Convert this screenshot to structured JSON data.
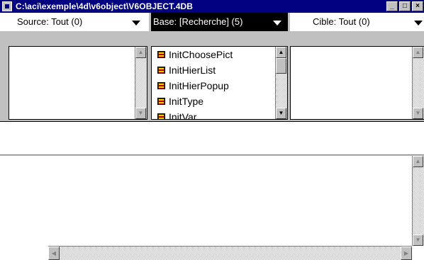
{
  "window": {
    "title": "C:\\aci\\exemple\\4d\\v6object\\V6OBJECT.4DB",
    "controls": {
      "minimize": "_",
      "maximize": "□",
      "close": "×"
    }
  },
  "headers": {
    "source": "Source: Tout (0)",
    "base": "Base: [Recherche] (5)",
    "cible": "Cible: Tout (0)"
  },
  "base_list": {
    "items": [
      "InitChoosePict",
      "InitHierList",
      "InitHierPopup",
      "InitType",
      "InitVar"
    ]
  },
  "icons": {
    "app": "4d-app-icon",
    "dropdown": "chevron-down-icon",
    "item": "method-icon",
    "up": "arrow-up-icon",
    "down": "arrow-down-icon",
    "left": "arrow-left-icon",
    "right": "arrow-right-icon"
  },
  "colors": {
    "titlebar": "#000080",
    "selected_header": "#000000",
    "window_bg": "#c0c0c0"
  }
}
